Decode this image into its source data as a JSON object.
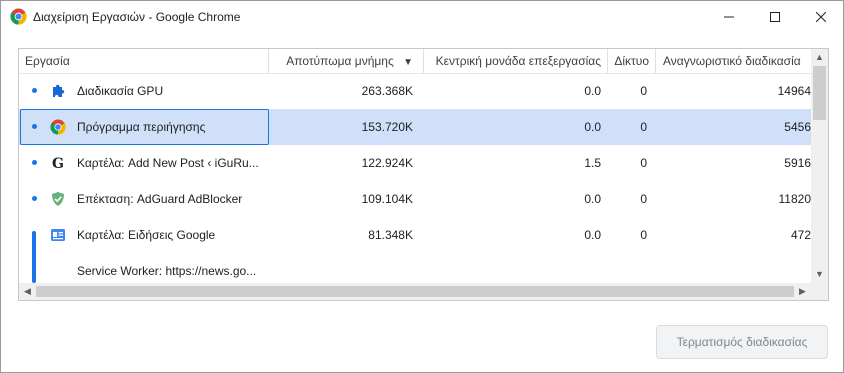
{
  "window": {
    "title": "Διαχείριση Εργασιών - Google Chrome",
    "icon": "chrome-icon"
  },
  "table": {
    "headers": {
      "task": "Εργασία",
      "memory": "Αποτύπωμα μνήμης",
      "memory_sort": "▼",
      "cpu": "Κεντρική μονάδα επεξεργασίας",
      "network": "Δίκτυο",
      "pid": "Αναγνωριστικό διαδικασία"
    },
    "rows": [
      {
        "icon": "puzzle-piece-icon",
        "task": "Διαδικασία GPU",
        "memory": "263.368K",
        "cpu": "0.0",
        "network": "0",
        "pid": "14964",
        "selected": false
      },
      {
        "icon": "chrome-icon",
        "task": "Πρόγραμμα περιήγησης",
        "memory": "153.720K",
        "cpu": "0.0",
        "network": "0",
        "pid": "5456",
        "selected": true
      },
      {
        "icon": "g-logo-icon",
        "task": "Καρτέλα: Add New Post ‹ iGuRu...",
        "memory": "122.924K",
        "cpu": "1.5",
        "network": "0",
        "pid": "5916",
        "selected": false
      },
      {
        "icon": "adguard-shield-icon",
        "task": "Επέκταση: AdGuard AdBlocker",
        "memory": "109.104K",
        "cpu": "0.0",
        "network": "0",
        "pid": "11820",
        "selected": false
      },
      {
        "icon": "google-news-icon",
        "task": "Καρτέλα: Ειδήσεις Google",
        "memory": "81.348K",
        "cpu": "0.0",
        "network": "0",
        "pid": "472",
        "selected": false
      },
      {
        "icon": "",
        "task": "Service Worker: https://news.go...",
        "memory": "",
        "cpu": "",
        "network": "",
        "pid": "",
        "selected": false
      }
    ]
  },
  "footer": {
    "end_process_label": "Τερματισμός διαδικασίας"
  },
  "colors": {
    "selection": "#cfe0f8",
    "accent": "#1a73e8",
    "adguard": "#67b279"
  }
}
